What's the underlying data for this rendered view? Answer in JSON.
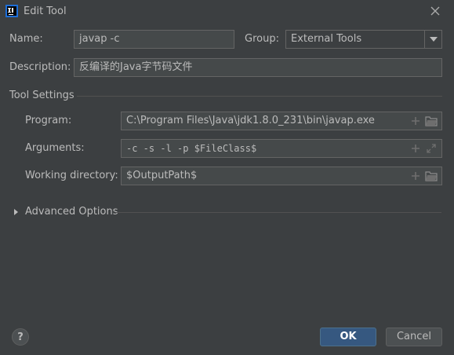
{
  "window": {
    "title": "Edit Tool",
    "app_icon": "intellij-idea-icon",
    "close_icon": "close-icon"
  },
  "name": {
    "label": "Name:",
    "value": "javap -c"
  },
  "group": {
    "label": "Group:",
    "value": "External Tools"
  },
  "description": {
    "label": "Description:",
    "value": "反编译的Java字节码文件"
  },
  "tool_settings": {
    "header": "Tool Settings",
    "program": {
      "label": "Program:",
      "value": "C:\\Program Files\\Java\\jdk1.8.0_231\\bin\\javap.exe"
    },
    "arguments": {
      "label": "Arguments:",
      "value": "-c -s -l -p $FileClass$"
    },
    "working_directory": {
      "label": "Working directory:",
      "value": "$OutputPath$"
    }
  },
  "advanced": {
    "label": "Advanced Options",
    "expanded": false
  },
  "buttons": {
    "ok": "OK",
    "cancel": "Cancel",
    "help": "?"
  },
  "colors": {
    "background": "#3c3f41",
    "field_bg": "#45494a",
    "ok_button": "#365880"
  }
}
